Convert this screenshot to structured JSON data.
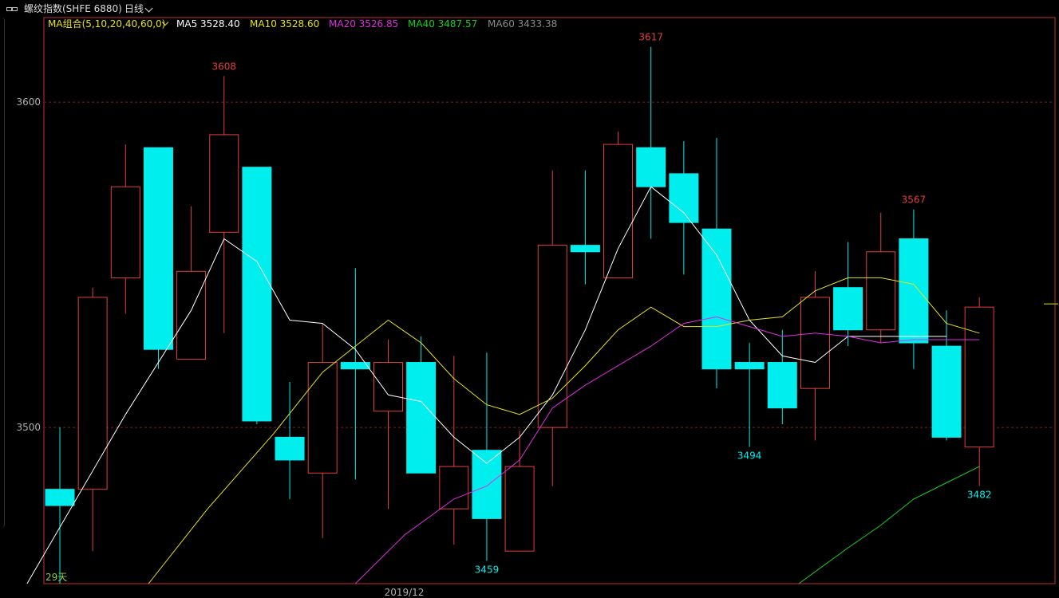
{
  "header": {
    "title": "螺纹指数(SHFE 6880)",
    "period": "日线"
  },
  "ma_legend": {
    "group_label": "MA组合(5,10,20,40,60,0)",
    "items": [
      {
        "label": "MA5 3528.40",
        "color": "#ffffff"
      },
      {
        "label": "MA10 3528.60",
        "color": "#e7e31a"
      },
      {
        "label": "MA20 3526.85",
        "color": "#e02de0"
      },
      {
        "label": "MA40 3487.57",
        "color": "#19d019"
      },
      {
        "label": "MA60 3433.38",
        "color": "#8a8a8a"
      }
    ]
  },
  "colors": {
    "up": "#e0403a",
    "down": "#00eeee",
    "grid": "#7a1f1f",
    "axis_text": "#b0b0b0",
    "frame": "#c03030"
  },
  "chart_data": {
    "type": "candlestick",
    "y_ticks": [
      3500,
      3600
    ],
    "ylim": [
      3452,
      3626
    ],
    "x_tick_label": "2019/12",
    "x_tick_index": 10,
    "bottom_left_label": "29天",
    "candles": [
      {
        "o": 3481,
        "h": 3500,
        "l": 3450,
        "c": 3476
      },
      {
        "o": 3481,
        "h": 3543,
        "l": 3462,
        "c": 3540
      },
      {
        "o": 3546,
        "h": 3587,
        "l": 3535,
        "c": 3574
      },
      {
        "o": 3586,
        "h": 3586,
        "l": 3518,
        "c": 3524
      },
      {
        "o": 3521,
        "h": 3568,
        "l": 3523,
        "c": 3548
      },
      {
        "o": 3560,
        "h": 3608,
        "l": 3529,
        "c": 3590
      },
      {
        "o": 3580,
        "h": 3580,
        "l": 3501,
        "c": 3502
      },
      {
        "o": 3497,
        "h": 3514,
        "l": 3478,
        "c": 3490
      },
      {
        "o": 3486,
        "h": 3532,
        "l": 3466,
        "c": 3520
      },
      {
        "o": 3520,
        "h": 3549,
        "l": 3484,
        "c": 3518
      },
      {
        "o": 3505,
        "h": 3527,
        "l": 3475,
        "c": 3520
      },
      {
        "o": 3520,
        "h": 3528,
        "l": 3486,
        "c": 3486
      },
      {
        "o": 3475,
        "h": 3522,
        "l": 3464,
        "c": 3488
      },
      {
        "o": 3493,
        "h": 3523,
        "l": 3459,
        "c": 3472
      },
      {
        "o": 3462,
        "h": 3499,
        "l": 3462,
        "c": 3488
      },
      {
        "o": 3500,
        "h": 3579,
        "l": 3482,
        "c": 3556
      },
      {
        "o": 3556,
        "h": 3579,
        "l": 3544,
        "c": 3554
      },
      {
        "o": 3546,
        "h": 3591,
        "l": 3546,
        "c": 3587
      },
      {
        "o": 3586,
        "h": 3617,
        "l": 3558,
        "c": 3574
      },
      {
        "o": 3578,
        "h": 3588,
        "l": 3547,
        "c": 3563
      },
      {
        "o": 3561,
        "h": 3589,
        "l": 3512,
        "c": 3518
      },
      {
        "o": 3520,
        "h": 3526,
        "l": 3494,
        "c": 3518
      },
      {
        "o": 3520,
        "h": 3530,
        "l": 3501,
        "c": 3506
      },
      {
        "o": 3512,
        "h": 3548,
        "l": 3496,
        "c": 3540
      },
      {
        "o": 3543,
        "h": 3557,
        "l": 3525,
        "c": 3530
      },
      {
        "o": 3530,
        "h": 3566,
        "l": 3526,
        "c": 3554
      },
      {
        "o": 3558,
        "h": 3567,
        "l": 3518,
        "c": 3526
      },
      {
        "o": 3525,
        "h": 3536,
        "l": 3496,
        "c": 3497
      },
      {
        "o": 3494,
        "h": 3540,
        "l": 3482,
        "c": 3537
      }
    ],
    "series": [
      {
        "name": "MA5",
        "color": "#ffffff",
        "points": [
          [
            -1,
            3452
          ],
          [
            2,
            3504
          ],
          [
            4,
            3536
          ],
          [
            5,
            3558
          ],
          [
            6,
            3551
          ],
          [
            7,
            3533
          ],
          [
            8,
            3532
          ],
          [
            9,
            3524
          ],
          [
            10,
            3510
          ],
          [
            11,
            3508
          ],
          [
            12,
            3497
          ],
          [
            13,
            3489
          ],
          [
            14,
            3497
          ],
          [
            15,
            3510
          ],
          [
            16,
            3530
          ],
          [
            17,
            3555
          ],
          [
            18,
            3574
          ],
          [
            19,
            3566
          ],
          [
            20,
            3553
          ],
          [
            21,
            3533
          ],
          [
            22,
            3522
          ],
          [
            23,
            3520
          ],
          [
            24,
            3528
          ],
          [
            25,
            3528
          ],
          [
            26,
            3528
          ],
          [
            27,
            3528
          ]
        ]
      },
      {
        "name": "MA10",
        "color": "#e7e31a",
        "points": [
          [
            2.7,
            3452
          ],
          [
            4.5,
            3475
          ],
          [
            6.5,
            3498
          ],
          [
            8,
            3517
          ],
          [
            9,
            3525
          ],
          [
            10,
            3533
          ],
          [
            11,
            3526
          ],
          [
            12,
            3515
          ],
          [
            13,
            3507
          ],
          [
            14,
            3504
          ],
          [
            15,
            3509
          ],
          [
            16,
            3519
          ],
          [
            17,
            3530
          ],
          [
            18,
            3537
          ],
          [
            19,
            3531
          ],
          [
            20,
            3531
          ],
          [
            21,
            3533
          ],
          [
            22,
            3534
          ],
          [
            23,
            3542
          ],
          [
            24,
            3546
          ],
          [
            25,
            3546
          ],
          [
            26,
            3544
          ],
          [
            27,
            3532
          ],
          [
            28,
            3529
          ]
        ]
      },
      {
        "name": "MA20",
        "color": "#e02de0",
        "points": [
          [
            9,
            3452
          ],
          [
            10.5,
            3467
          ],
          [
            12,
            3478
          ],
          [
            13,
            3482
          ],
          [
            14,
            3490
          ],
          [
            15,
            3506
          ],
          [
            16,
            3513
          ],
          [
            17,
            3519
          ],
          [
            18,
            3525
          ],
          [
            19,
            3532
          ],
          [
            20,
            3534
          ],
          [
            21,
            3531
          ],
          [
            22,
            3528
          ],
          [
            23,
            3529
          ],
          [
            24,
            3528
          ],
          [
            25,
            3526
          ],
          [
            26,
            3527
          ],
          [
            27,
            3527
          ],
          [
            28,
            3527
          ]
        ]
      },
      {
        "name": "MA40",
        "color": "#19d019",
        "points": [
          [
            22.5,
            3452
          ],
          [
            24,
            3463
          ],
          [
            25,
            3470
          ],
          [
            26,
            3478
          ],
          [
            27,
            3483
          ],
          [
            28,
            3488
          ]
        ]
      }
    ],
    "annotations": [
      {
        "text": "3608",
        "index": 5,
        "value": 3608,
        "pos": "above",
        "kind": "high"
      },
      {
        "text": "3617",
        "index": 18,
        "value": 3617,
        "pos": "above",
        "kind": "high"
      },
      {
        "text": "3567",
        "index": 26,
        "value": 3567,
        "pos": "above",
        "kind": "high"
      },
      {
        "text": "3459",
        "index": 13,
        "value": 3459,
        "pos": "below",
        "kind": "low"
      },
      {
        "text": "3494",
        "index": 21,
        "value": 3494,
        "pos": "below",
        "kind": "low"
      },
      {
        "text": "3482",
        "index": 28,
        "value": 3482,
        "pos": "below",
        "kind": "low"
      }
    ]
  }
}
